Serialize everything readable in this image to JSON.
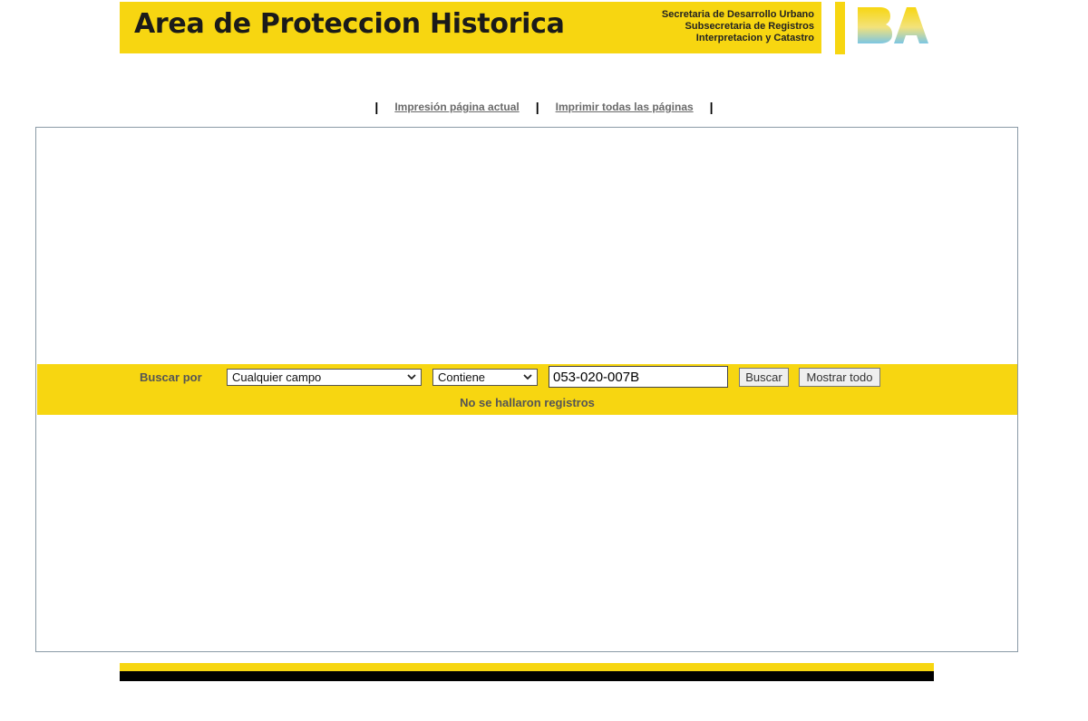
{
  "header": {
    "title": "Area de Proteccion Historica",
    "dept_lines": [
      "Secretaria de Desarrollo Urbano",
      "Subsecretaria de Registros",
      "Interpretacion y Catastro"
    ],
    "logo_icon": "ba-logo-icon",
    "logo_text": "BA",
    "brand_color": "#f7d611"
  },
  "print_links": {
    "current_page": "Impresión página actual",
    "all_pages": "Imprimir todas las páginas",
    "separator": "|"
  },
  "search": {
    "label": "Buscar por",
    "field_select": {
      "selected": "Cualquier campo"
    },
    "operator_select": {
      "selected": "Contiene"
    },
    "query_value": "053-020-007B",
    "search_button": "Buscar",
    "show_all_button": "Mostrar todo",
    "status_message": "No se hallaron registros"
  }
}
